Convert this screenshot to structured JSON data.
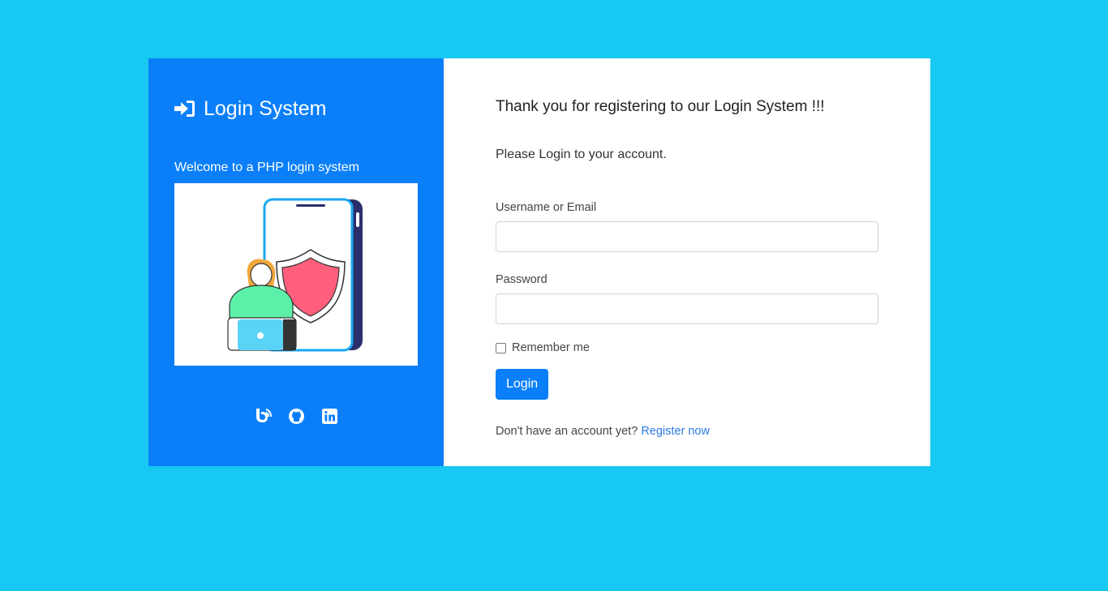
{
  "brand": {
    "title": "Login System",
    "icon": "sign-in-icon"
  },
  "sidebar": {
    "welcome": "Welcome to a PHP login system",
    "illustration": "phone-security-illustration",
    "socials": [
      {
        "name": "blog-icon"
      },
      {
        "name": "github-icon"
      },
      {
        "name": "linkedin-icon"
      }
    ]
  },
  "main": {
    "heading": "Thank you for registering to our Login System !!!",
    "prompt": "Please Login to your account.",
    "username_label": "Username or Email",
    "username_value": "",
    "password_label": "Password",
    "password_value": "",
    "remember_label": "Remember me",
    "remember_checked": false,
    "login_button": "Login",
    "signup_text": "Don't have an account yet?",
    "signup_link": "Register now"
  },
  "colors": {
    "page_bg": "#17c8f2",
    "brand_panel": "#0a7ff9",
    "link": "#2b7be9"
  }
}
